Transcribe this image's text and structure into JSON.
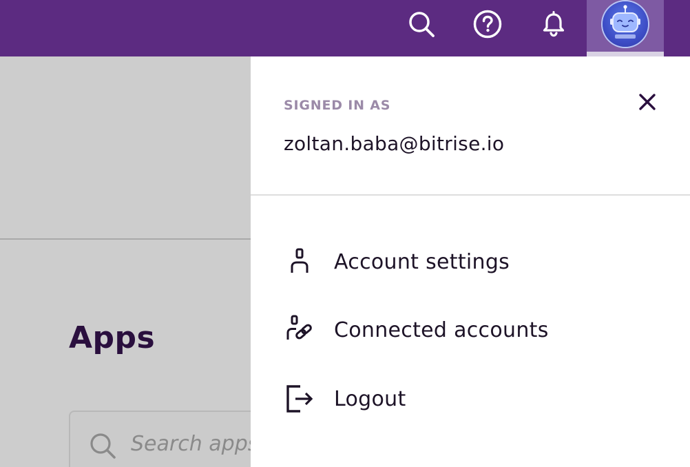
{
  "topbar": {
    "icons": [
      "search-icon",
      "help-icon",
      "bell-icon"
    ],
    "avatar": "robot-avatar"
  },
  "background": {
    "title": "Apps",
    "search": {
      "placeholder": "Search apps"
    }
  },
  "account_menu": {
    "signed_in_label": "SIGNED IN AS",
    "email": "zoltan.baba@bitrise.io",
    "items": [
      {
        "label": "Account settings",
        "icon": "person-icon"
      },
      {
        "label": "Connected accounts",
        "icon": "person-link-icon"
      },
      {
        "label": "Logout",
        "icon": "logout-icon"
      }
    ]
  },
  "colors": {
    "topbar": "#5c2b81",
    "avatar_tab": "#7e5aa3",
    "overlay": "#cdcdcd",
    "title": "#2a0f3e",
    "label_muted": "#9b8aa8"
  }
}
